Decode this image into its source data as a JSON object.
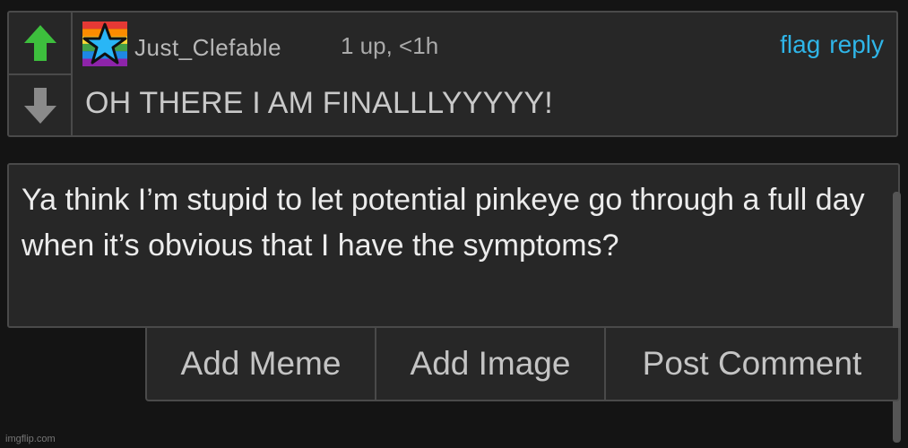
{
  "comment": {
    "username": "Just_Clefable",
    "meta": "1 up, <1h",
    "actions": {
      "flag": "flag",
      "reply": "reply"
    },
    "text": "OH THERE I AM FINALLLYYYYY!",
    "upvote_color": "#3dbf3d",
    "downvote_color": "#8a8a8a",
    "avatar_icon": "rainbow-star-icon"
  },
  "reply": {
    "text": "Ya think I’m stupid to let potential pinkeye go through a full day when it’s obvious that I have the symptoms?"
  },
  "buttons": {
    "add_meme": "Add Meme",
    "add_image": "Add Image",
    "post_comment": "Post Comment"
  },
  "watermark": "imgflip.com",
  "colors": {
    "link": "#2fb5e8",
    "background": "#141414",
    "panel": "#272727"
  }
}
